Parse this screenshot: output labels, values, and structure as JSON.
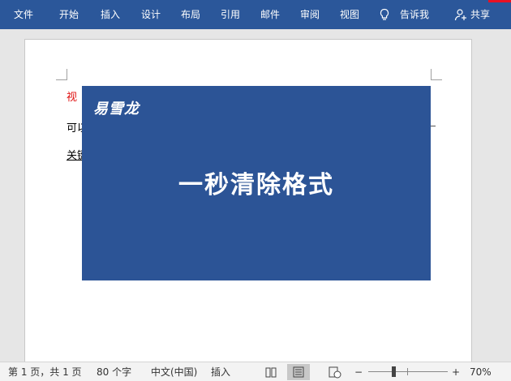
{
  "ribbon": {
    "tabs": [
      "文件",
      "开始",
      "插入",
      "设计",
      "布局",
      "引用",
      "邮件",
      "审阅",
      "视图"
    ],
    "tell_me": "告诉我",
    "share": "共享",
    "icons": {
      "tell_me": "lightbulb-icon",
      "share": "person-add-icon"
    },
    "colors": {
      "background": "#2b579a",
      "accent": "#e81123"
    }
  },
  "document": {
    "lines": [
      {
        "text": "视",
        "style": "red"
      },
      {
        "text": "可以",
        "style": "normal"
      },
      {
        "text": "关键",
        "style": "underline"
      }
    ],
    "overlay": {
      "logo": "易雪龙",
      "headline": "一秒清除格式",
      "background": "#2c5496"
    }
  },
  "status": {
    "page": "第 1 页，共 1 页",
    "words": "80 个字",
    "language": "中文(中国)",
    "mode": "插入",
    "zoom_minus": "−",
    "zoom_plus": "+",
    "zoom": "70%",
    "zoom_level": 70,
    "icons": [
      "read-mode-icon",
      "print-layout-icon",
      "web-layout-icon"
    ]
  }
}
